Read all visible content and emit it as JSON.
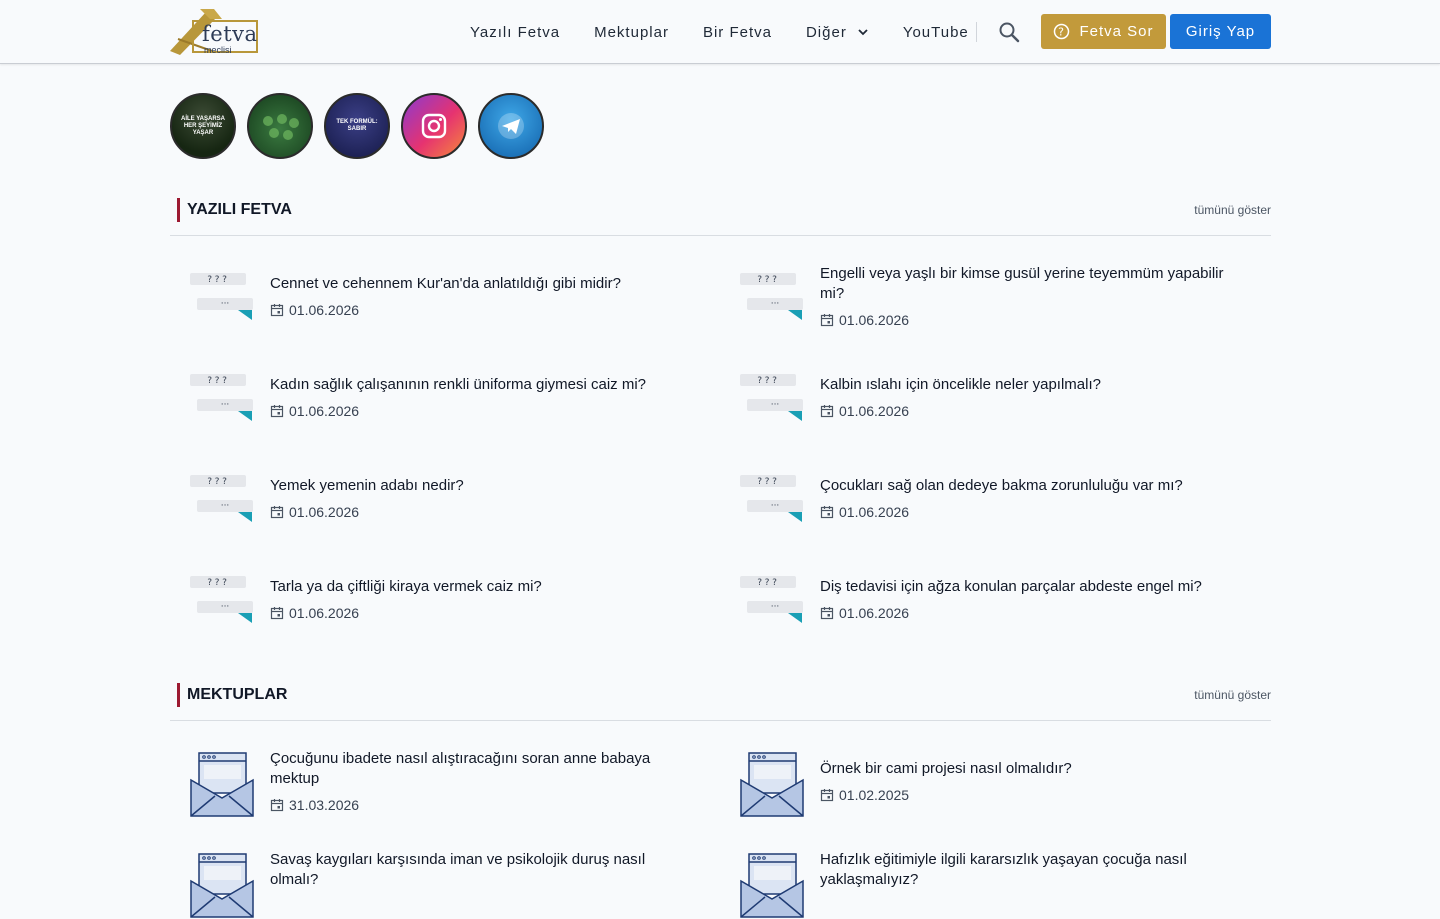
{
  "header": {
    "logo_text": "fetva",
    "logo_sub": "meclisi",
    "nav": [
      "Yazılı Fetva",
      "Mektuplar",
      "Bir Fetva",
      "Diğer",
      "YouTube"
    ],
    "ask_label": "Fetva Sor",
    "login_label": "Giriş Yap"
  },
  "stories": [
    {
      "text": "AİLE YAŞARSA HER ŞEYİMİZ YAŞAR"
    },
    {
      "text": ""
    },
    {
      "text": "TEK FORMÜL: SABIR"
    },
    {
      "text": ""
    },
    {
      "text": ""
    }
  ],
  "sections": {
    "yazili": {
      "title": "YAZILI FETVA",
      "more": "tümünü göster",
      "items": [
        {
          "title": "Cennet ve cehennem Kur'an'da anlatıldığı gibi midir?",
          "date": "01.06.2026"
        },
        {
          "title": "Engelli veya yaşlı bir kimse gusül yerine teyemmüm yapabilir mi?",
          "date": "01.06.2026"
        },
        {
          "title": "Kadın sağlık çalışanının renkli üniforma giymesi caiz mi?",
          "date": "01.06.2026"
        },
        {
          "title": "Kalbin ıslahı için öncelikle neler yapılmalı?",
          "date": "01.06.2026"
        },
        {
          "title": "Yemek yemenin adabı nedir?",
          "date": "01.06.2026"
        },
        {
          "title": "Çocukları sağ olan dedeye bakma zorunluluğu var mı?",
          "date": "01.06.2026"
        },
        {
          "title": "Tarla ya da çiftliği kiraya vermek caiz mi?",
          "date": "01.06.2026"
        },
        {
          "title": "Diş tedavisi için ağza konulan parçalar abdeste engel mi?",
          "date": "01.06.2026"
        }
      ]
    },
    "mektuplar": {
      "title": "MEKTUPLAR",
      "more": "tümünü göster",
      "items": [
        {
          "title": "Çocuğunu ibadete nasıl alıştıracağını soran anne babaya mektup",
          "date": "31.03.2026"
        },
        {
          "title": "Örnek bir cami projesi nasıl olmalıdır?",
          "date": "01.02.2025"
        },
        {
          "title": "Savaş kaygıları karşısında iman ve psikolojik duruş nasıl olmalı?",
          "date": ""
        },
        {
          "title": "Hafızlık eğitimiyle ilgili kararsızlık yaşayan çocuğa nasıl yaklaşmalıyız?",
          "date": ""
        }
      ]
    }
  }
}
